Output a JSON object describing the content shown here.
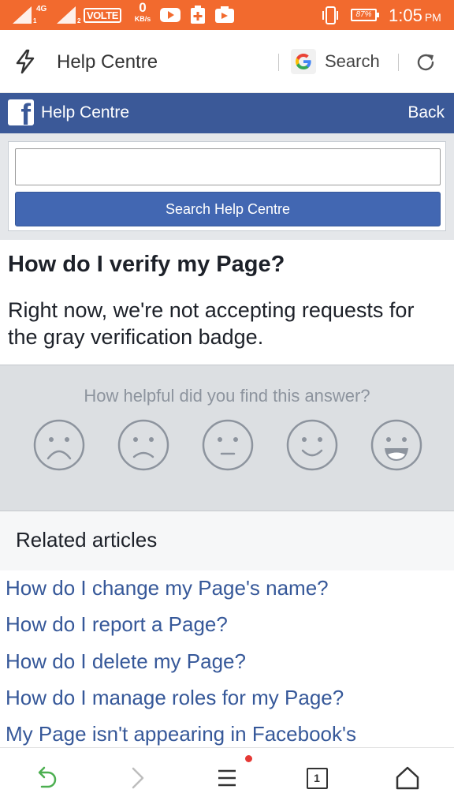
{
  "status_bar": {
    "network_1": "4G",
    "sim_1": "1",
    "sim_2": "2",
    "volte": "VOLTE",
    "speed_value": "0",
    "speed_unit": "KB/s",
    "battery": "87%",
    "time": "1:05",
    "ampm": "PM",
    "color": "#f26a2e"
  },
  "browser": {
    "page_title": "Help Centre",
    "search_label": "Search"
  },
  "header": {
    "logo_letter": "f",
    "title": "Help Centre",
    "back_label": "Back",
    "color": "#3b5998"
  },
  "search": {
    "input_value": "",
    "button_label": "Search Help Centre"
  },
  "article": {
    "title": "How do I verify my Page?",
    "body": "Right now, we're not accepting requests for the gray verification badge."
  },
  "feedback": {
    "question": "How helpful did you find this answer?",
    "ratings": [
      "very-sad",
      "sad",
      "neutral",
      "happy",
      "very-happy"
    ]
  },
  "related": {
    "heading": "Related articles",
    "links": [
      "How do I change my Page's name?",
      "How do I report a Page?",
      "How do I delete my Page?",
      "How do I manage roles for my Page?",
      "My Page isn't appearing in Facebook's"
    ]
  },
  "bottom_nav": {
    "tab_count": "1",
    "accent": "#4caf50"
  }
}
